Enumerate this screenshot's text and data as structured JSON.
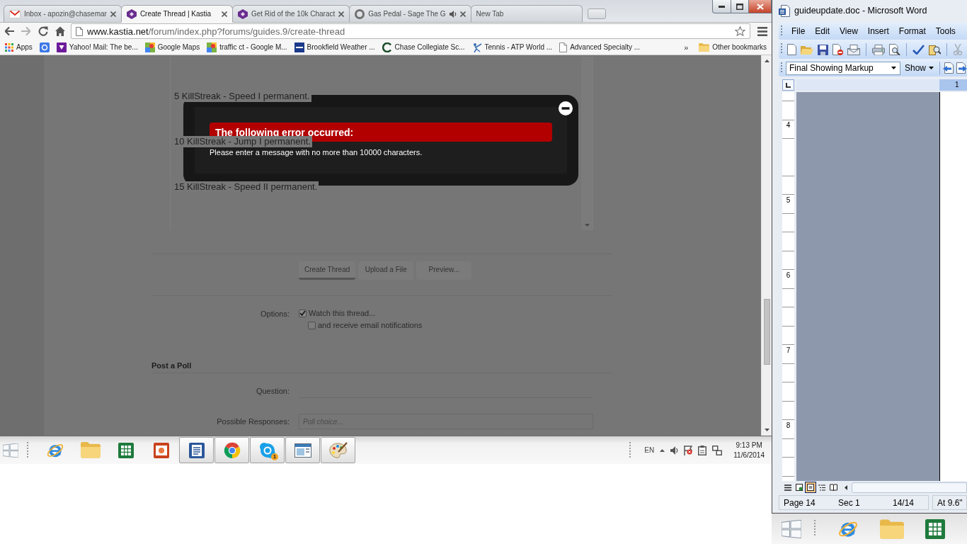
{
  "browser": {
    "tabs": [
      {
        "title": "Inbox - apozin@chasemar",
        "selected": false,
        "audio": false
      },
      {
        "title": "Create Thread | Kastia",
        "selected": true,
        "audio": false
      },
      {
        "title": "Get Rid of the 10k Charact",
        "selected": false,
        "audio": false
      },
      {
        "title": "Gas Pedal - Sage The G",
        "selected": false,
        "audio": true
      },
      {
        "title": "New Tab",
        "selected": false,
        "audio": false
      }
    ],
    "address": {
      "host": "www.kastia.net",
      "path": "/forum/index.php?forums/guides.9/create-thread"
    },
    "bookmarks": [
      {
        "kind": "labeled",
        "label": "Apps"
      },
      {
        "kind": "icon_only"
      },
      {
        "kind": "labeled",
        "label": "Yahoo! Mail: The be..."
      },
      {
        "kind": "labeled",
        "label": "Google Maps"
      },
      {
        "kind": "labeled",
        "label": "traffic ct - Google M..."
      },
      {
        "kind": "labeled",
        "label": "Brookfield Weather ..."
      },
      {
        "kind": "labeled",
        "label": "Chase Collegiate Sc..."
      },
      {
        "kind": "labeled",
        "label": "Tennis - ATP World ..."
      },
      {
        "kind": "labeled",
        "label": "Advanced Specialty ..."
      }
    ],
    "bookmarks_overflow": "»",
    "other_bookmarks": "Other bookmarks"
  },
  "page": {
    "editor_lines": [
      "5 KillStreak - Speed I permanent.",
      "10 KillStreak - Jump I permanent.",
      "15 KillStreak - Speed II permanent."
    ],
    "buttons": [
      {
        "label": "Create Thread",
        "primary": true
      },
      {
        "label": "Upload a File",
        "primary": false
      },
      {
        "label": "Preview...",
        "primary": false
      }
    ],
    "options": {
      "label": "Options:",
      "items": [
        {
          "label": "Watch this thread...",
          "checked": true,
          "children": [
            {
              "label": "and receive email notifications",
              "checked": false
            }
          ]
        }
      ]
    },
    "poll": {
      "title": "Post a Poll",
      "fields": [
        {
          "label": "Question:"
        },
        {
          "label": "Possible Responses:",
          "placeholder": "Poll choice..."
        }
      ]
    }
  },
  "dialog": {
    "heading": "The following error occurred:",
    "message": "Please enter a message with no more than 10000 characters."
  },
  "taskbar": {
    "apps": [
      {
        "running": false
      },
      {
        "running": false
      },
      {
        "running": false
      },
      {
        "running": false
      },
      {
        "running": true
      },
      {
        "running": true
      },
      {
        "running": true,
        "badge": "1"
      },
      {
        "running": true
      },
      {
        "running": true
      }
    ],
    "language": "EN",
    "time": "9:13 PM",
    "date": "11/6/2014"
  },
  "word": {
    "title": "guideupdate.doc - Microsoft Word",
    "menu": [
      "File",
      "Edit",
      "View",
      "Insert",
      "Format",
      "Tools"
    ],
    "markup_mode": "Final Showing Markup",
    "show_menu": "Show",
    "ruler_label": "1",
    "vertical_ruler": [
      "4",
      "5",
      "6",
      "7",
      "8"
    ],
    "views": [
      {
        "selected": false
      },
      {
        "selected": false
      },
      {
        "selected": true
      },
      {
        "selected": false
      },
      {
        "selected": false
      }
    ],
    "status": [
      "Page 14",
      "Sec 1",
      "14/14",
      "At 9.6\""
    ]
  }
}
